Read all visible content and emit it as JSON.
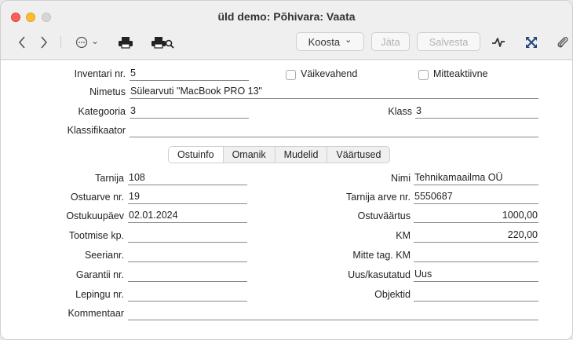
{
  "window": {
    "title": "üld demo: Põhivara: Vaata"
  },
  "toolbar": {
    "back_icon": "chevron-left-icon",
    "forward_icon": "chevron-right-icon",
    "more_icon": "ellipsis-circle-icon",
    "more_chevron": "⌄",
    "print_icon": "printer-icon",
    "print_preview_icon": "print-preview-icon",
    "create_label": "Koosta",
    "create_chevron": "⌄",
    "leave_label": "Jäta",
    "save_label": "Salvesta",
    "tools": [
      "activity-icon",
      "expand-icon",
      "paperclip-icon"
    ]
  },
  "form": {
    "inventory_nr_label": "Inventari nr.",
    "inventory_nr_value": "5",
    "small_tool_label": "Väikevahend",
    "inactive_label": "Mitteaktiivne",
    "name_label": "Nimetus",
    "name_value": "Sülearvuti \"MacBook PRO 13\"",
    "category_label": "Kategooria",
    "category_value": "3",
    "class_label": "Klass",
    "class_value": "3",
    "classifier_label": "Klassifikaator",
    "classifier_value": ""
  },
  "tabs": [
    {
      "label": "Ostuinfo",
      "active": true
    },
    {
      "label": "Omanik",
      "active": false
    },
    {
      "label": "Mudelid",
      "active": false
    },
    {
      "label": "Väärtused",
      "active": false
    }
  ],
  "purchase": {
    "supplier_label": "Tarnija",
    "supplier_value": "108",
    "name_label": "Nimi",
    "name_value": "Tehnikamaailma OÜ",
    "invoice_label": "Ostuarve nr.",
    "invoice_value": "19",
    "supplier_invoice_label": "Tarnija arve nr.",
    "supplier_invoice_value": "5550687",
    "purchase_date_label": "Ostukuupäev",
    "purchase_date_value": "02.01.2024",
    "purchase_value_label": "Ostuväärtus",
    "purchase_value_value": "1000,00",
    "production_date_label": "Tootmise kp.",
    "production_date_value": "",
    "vat_label": "KM",
    "vat_value": "220,00",
    "serial_label": "Seerianr.",
    "serial_value": "",
    "non_refund_vat_label": "Mitte tag. KM",
    "non_refund_vat_value": "",
    "warranty_label": "Garantii nr.",
    "warranty_value": "",
    "new_used_label": "Uus/kasutatud",
    "new_used_value": "Uus",
    "contract_label": "Lepingu nr.",
    "contract_value": "",
    "objects_label": "Objektid",
    "objects_value": "",
    "comment_label": "Kommentaar",
    "comment_value": ""
  }
}
